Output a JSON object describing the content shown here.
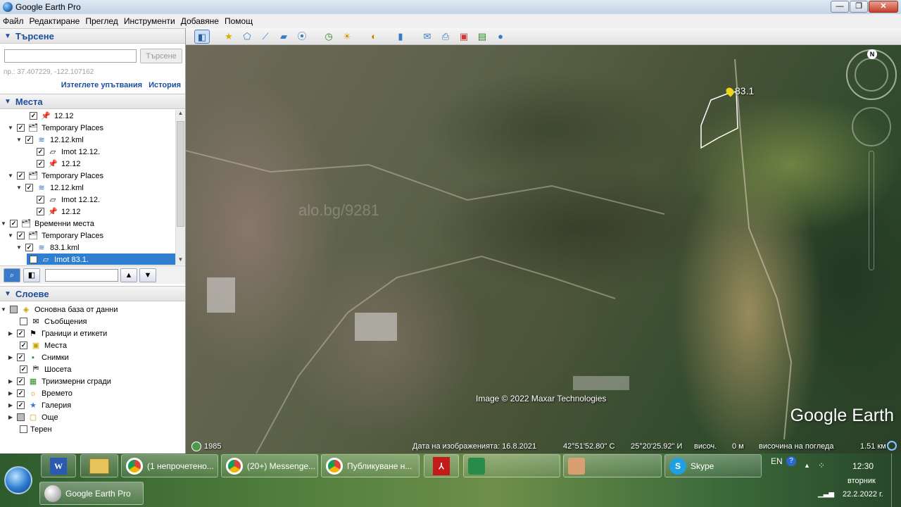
{
  "window": {
    "title": "Google Earth Pro"
  },
  "menu": [
    "Файл",
    "Редактиране",
    "Преглед",
    "Инструменти",
    "Добавяне",
    "Помощ"
  ],
  "search": {
    "header": "Търсене",
    "placeholder": "",
    "button": "Търсене",
    "hint": "пр.: 37.407229, -122.107162",
    "clear_link": "Изтеглете упътвания",
    "history_link": "История"
  },
  "places": {
    "header": "Места",
    "items": [
      {
        "label": "12.12",
        "icon": "pin-icon"
      },
      {
        "label": "Temporary Places",
        "icon": "folder-icon"
      },
      {
        "label": "12.12.kml",
        "icon": "kml-icon"
      },
      {
        "label": "Imot 12.12.",
        "icon": "polygon-icon"
      },
      {
        "label": "12.12",
        "icon": "pin-icon"
      },
      {
        "label": "Temporary Places",
        "icon": "folder-icon"
      },
      {
        "label": "12.12.kml",
        "icon": "kml-icon"
      },
      {
        "label": "Imot 12.12.",
        "icon": "polygon-icon"
      },
      {
        "label": "12.12",
        "icon": "pin-icon"
      },
      {
        "label": "Временни места",
        "icon": "folder-icon"
      },
      {
        "label": "Temporary Places",
        "icon": "folder-icon"
      },
      {
        "label": "83.1.kml",
        "icon": "kml-icon"
      },
      {
        "label": "Imot 83.1.",
        "icon": "polygon-icon"
      }
    ]
  },
  "layers": {
    "header": "Слоеве",
    "items": [
      {
        "label": "Основна база от данни",
        "icon": "database-icon"
      },
      {
        "label": "Съобщения",
        "icon": "envelope-icon"
      },
      {
        "label": "Граници и етикети",
        "icon": "flag-icon"
      },
      {
        "label": "Места",
        "icon": "places-icon"
      },
      {
        "label": "Снимки",
        "icon": "photo-icon"
      },
      {
        "label": "Шосета",
        "icon": "road-icon"
      },
      {
        "label": "Триизмерни сгради",
        "icon": "building-icon"
      },
      {
        "label": "Времето",
        "icon": "weather-icon"
      },
      {
        "label": "Галерия",
        "icon": "star-icon"
      },
      {
        "label": "Още",
        "icon": "more-icon"
      },
      {
        "label": "Терен",
        "icon": "terrain-icon"
      }
    ]
  },
  "map": {
    "pin_label": "83.1",
    "watermark": "alo.bg/9281",
    "credit": "Image © 2022 Maxar Technologies",
    "logo": "Google Earth",
    "historical_year": "1985",
    "status": {
      "date": "Дата на изображенията: 16.8.2021",
      "lat": "42°51'52.80\" С",
      "lon": "25°20'25.92\" И",
      "elev_label": "височ.",
      "elev_value": "0 м",
      "eye_label": "височина на погледа",
      "eye_value": "1.51 км"
    },
    "compass_n": "N"
  },
  "taskbar": {
    "pinned_earth": "Google Earth Pro",
    "tabs": [
      "(1 непрочетено...",
      "(20+) Messenge...",
      "Публикуване н...",
      "Skype"
    ],
    "lang": "EN",
    "time": "12:30",
    "day": "вторник",
    "date": "22.2.2022 г."
  }
}
